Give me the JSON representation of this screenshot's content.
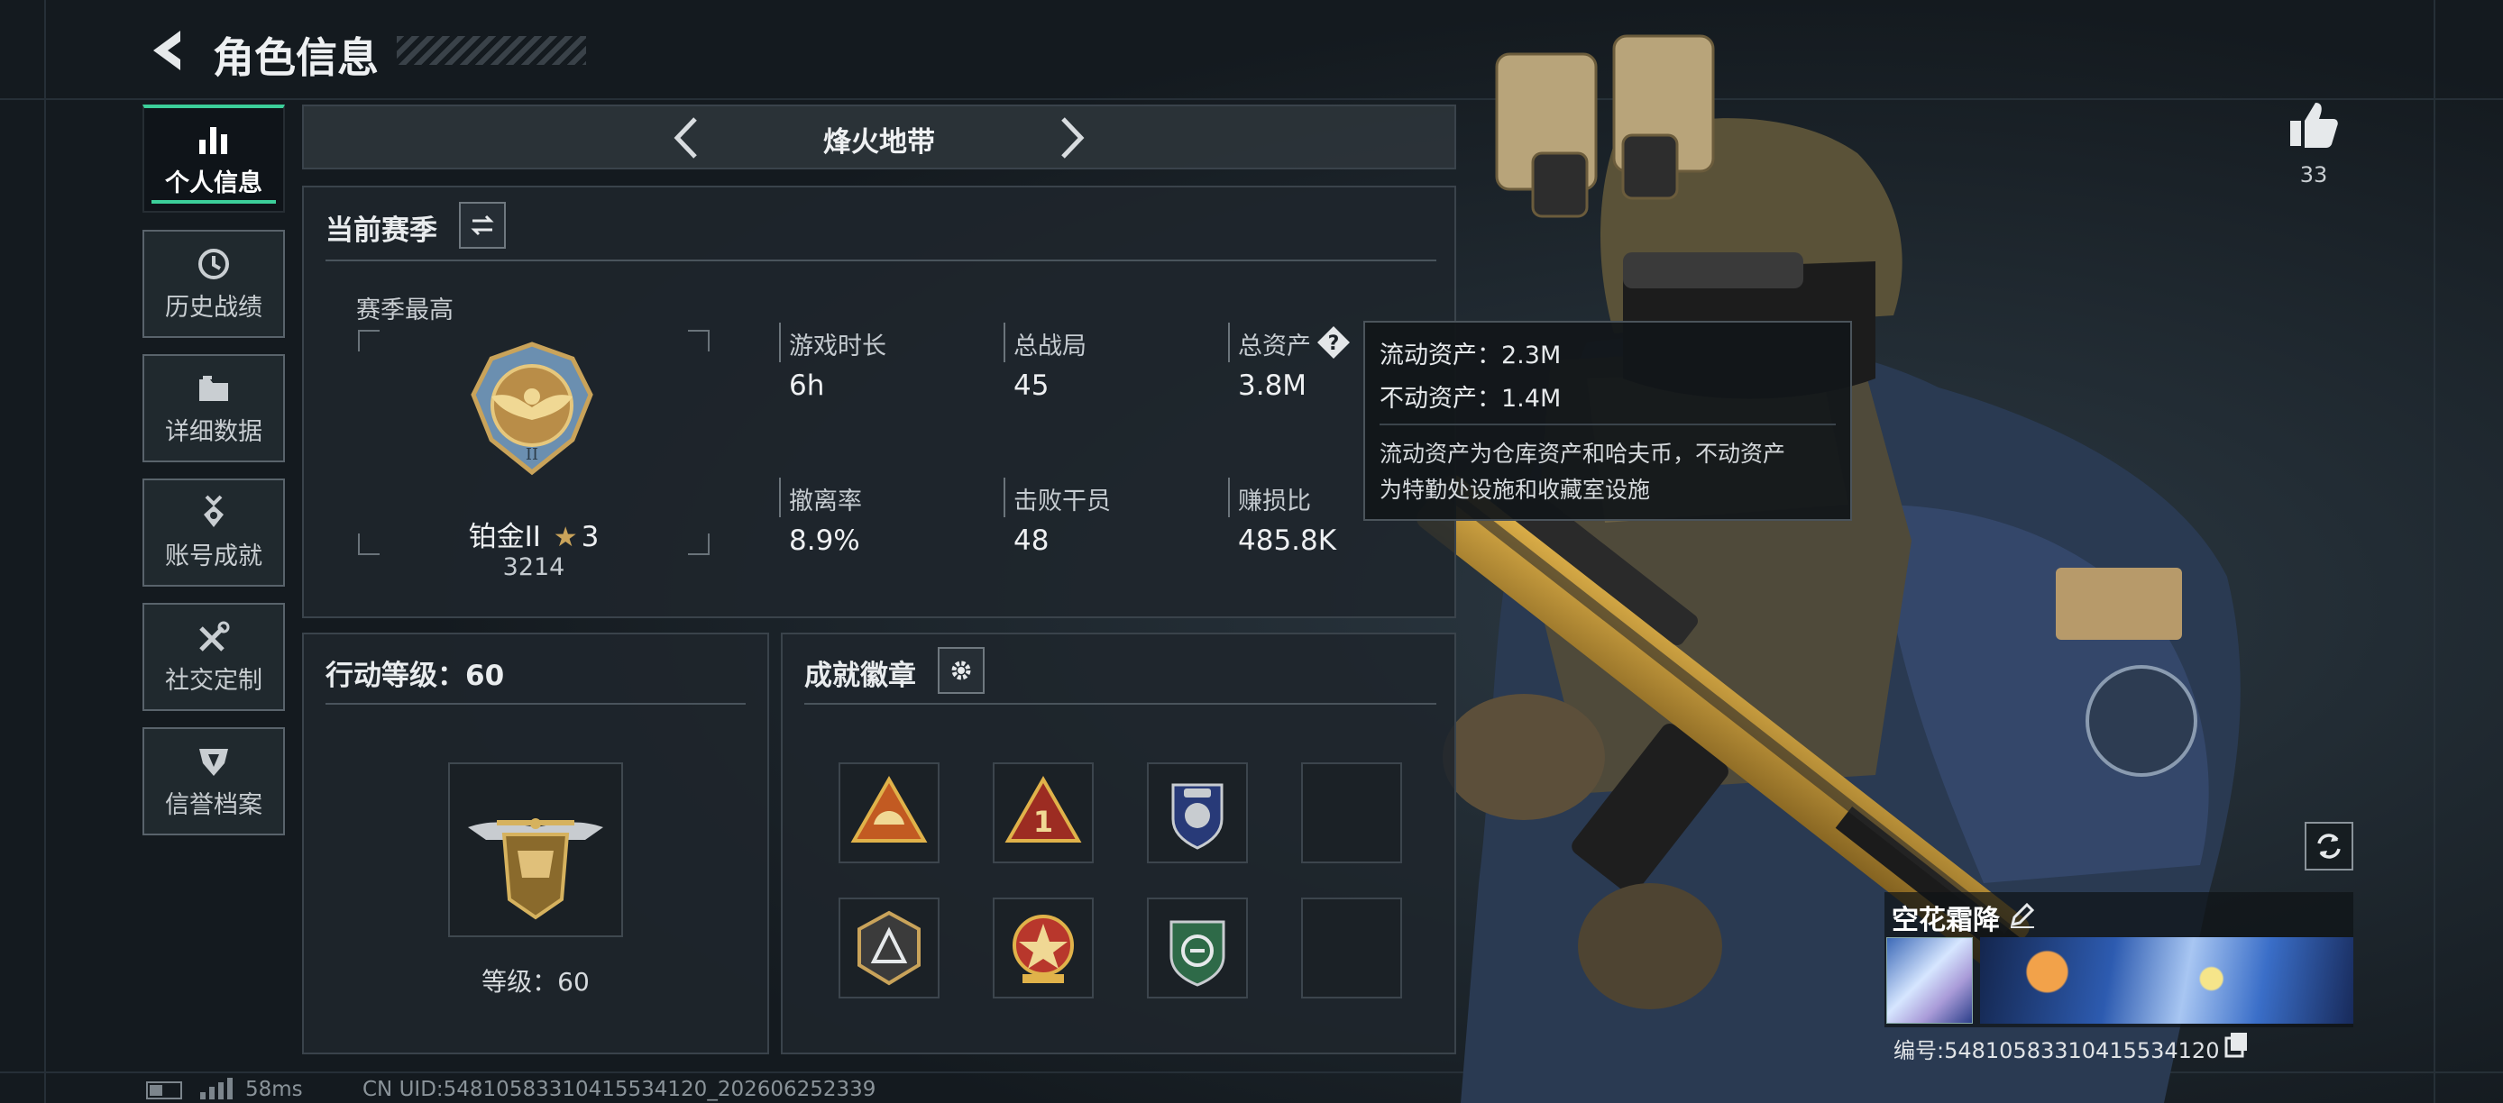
{
  "header": {
    "title": "角色信息"
  },
  "sidebar": {
    "items": [
      {
        "label": "个人信息",
        "icon": "bar-chart-icon",
        "active": true
      },
      {
        "label": "历史战绩",
        "icon": "clock-icon"
      },
      {
        "label": "详细数据",
        "icon": "folder-icon"
      },
      {
        "label": "账号成就",
        "icon": "medal-icon"
      },
      {
        "label": "社交定制",
        "icon": "tools-icon"
      },
      {
        "label": "信誉档案",
        "icon": "shield-icon"
      }
    ]
  },
  "mode": {
    "title": "烽火地带"
  },
  "season": {
    "title": "当前赛季",
    "best_label": "赛季最高",
    "rank_name": "铂金II",
    "rank_stars": "3",
    "rank_points": "3214",
    "stats": [
      {
        "label": "游戏时长",
        "value": "6h"
      },
      {
        "label": "总战局",
        "value": "45"
      },
      {
        "label": "总资产",
        "value": "3.8M"
      },
      {
        "label": "撤离率",
        "value": "8.9%"
      },
      {
        "label": "击败干员",
        "value": "48"
      },
      {
        "label": "赚损比",
        "value": "485.8K"
      }
    ]
  },
  "tooltip": {
    "line1": "流动资产：2.3M",
    "line2": "不动资产：1.4M",
    "desc1": "流动资产为仓库资产和哈夫币，不动资产",
    "desc2": "为特勤处设施和收藏室设施"
  },
  "level": {
    "title": "行动等级：60",
    "caption": "等级：60"
  },
  "badges": {
    "title": "成就徽章",
    "items": [
      {
        "icon": "triangle-helmet-badge-icon"
      },
      {
        "icon": "triangle-one-badge-icon"
      },
      {
        "icon": "police-shield-badge-icon"
      },
      {
        "icon": "empty-badge-slot"
      },
      {
        "icon": "shield-a-badge-icon"
      },
      {
        "icon": "star-medal-badge-icon"
      },
      {
        "icon": "green-emblem-badge-icon"
      },
      {
        "icon": "empty-badge-slot"
      }
    ]
  },
  "likes": {
    "count": "33"
  },
  "player": {
    "name": "空花霜降",
    "id_text": "编号:54810583310415534120"
  },
  "status": {
    "ping": "58ms",
    "uid": "CN UID:54810583310415534120_202606252339"
  },
  "colors": {
    "accent": "#3ccf9a",
    "background": "#1a1f24",
    "panel": "#1f262c",
    "gold": "#c9a35a"
  }
}
